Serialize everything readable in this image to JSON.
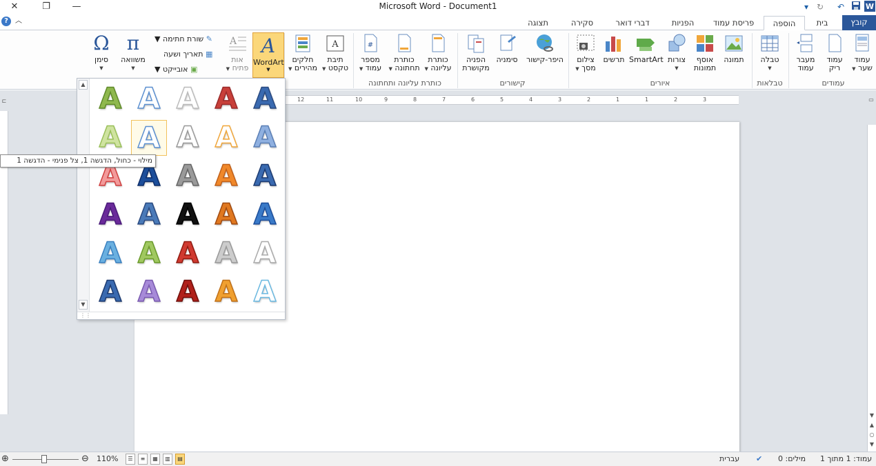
{
  "window": {
    "title": "Microsoft Word - Document1",
    "close_glyph": "✕",
    "restore_glyph": "❐",
    "minimize_glyph": "—"
  },
  "tabs": [
    {
      "label": "קובץ",
      "state": "file"
    },
    {
      "label": "בית",
      "state": "normal"
    },
    {
      "label": "הוספה",
      "state": "active"
    },
    {
      "label": "פריסת עמוד",
      "state": "normal"
    },
    {
      "label": "הפניות",
      "state": "normal"
    },
    {
      "label": "דברי דואר",
      "state": "normal"
    },
    {
      "label": "סקירה",
      "state": "normal"
    },
    {
      "label": "תצוגה",
      "state": "normal"
    }
  ],
  "ribbon": {
    "groups": {
      "pages": "עמודים",
      "tables": "טבלאות",
      "illustrations": "איורים",
      "links": "קישורים",
      "header_footer": "כותרת עליונה ותחתונה"
    },
    "buttons": {
      "cover_page": [
        "עמוד",
        "שער"
      ],
      "blank_page": [
        "עמוד",
        "ריק"
      ],
      "page_break": [
        "מעבר",
        "עמוד"
      ],
      "table": [
        "טבלה"
      ],
      "picture": [
        "תמונה"
      ],
      "clip_art": [
        "אוסף",
        "תמונות"
      ],
      "shapes": [
        "צורות"
      ],
      "smartart": [
        "SmartArt"
      ],
      "chart": [
        "תרשים"
      ],
      "screenshot": [
        "צילום",
        "מסך"
      ],
      "hyperlink": [
        "היפר-קישור"
      ],
      "bookmark": [
        "סימניה"
      ],
      "cross_reference": [
        "הפניה",
        "מקושרת"
      ],
      "header": [
        "כותרת",
        "עליונה"
      ],
      "footer": [
        "כותרת",
        "תחתונה"
      ],
      "page_number": [
        "מספר",
        "עמוד"
      ],
      "text_box": [
        "תיבת",
        "טקסט"
      ],
      "quick_parts": [
        "חלקים",
        "מהירים"
      ],
      "wordart": [
        "WordArt"
      ],
      "drop_cap": [
        "אות",
        "פתיח"
      ],
      "equation": [
        "משוואה"
      ],
      "symbol": [
        "סימן"
      ]
    },
    "small": {
      "signature_line": "שורת חתימה",
      "date_time": "תאריך ושעה",
      "object": "אובייקט"
    }
  },
  "gallery": {
    "tooltip": "מילוי - כחול, הדגשה 1, צל פנימי - הדגשה 1",
    "letter": "A"
  },
  "ruler_marks": [
    "12",
    "11",
    "10",
    "9",
    "8",
    "7",
    "6",
    "5",
    "4",
    "3",
    "2",
    "1",
    "1",
    "2",
    "3"
  ],
  "status": {
    "page": "עמוד: 1 מתוך 1",
    "words": "מילים: 0",
    "language": "עברית",
    "zoom": "110%"
  },
  "colors": {
    "file_tab": "#2b579a",
    "wordart_highlight": "#fbd77a"
  }
}
